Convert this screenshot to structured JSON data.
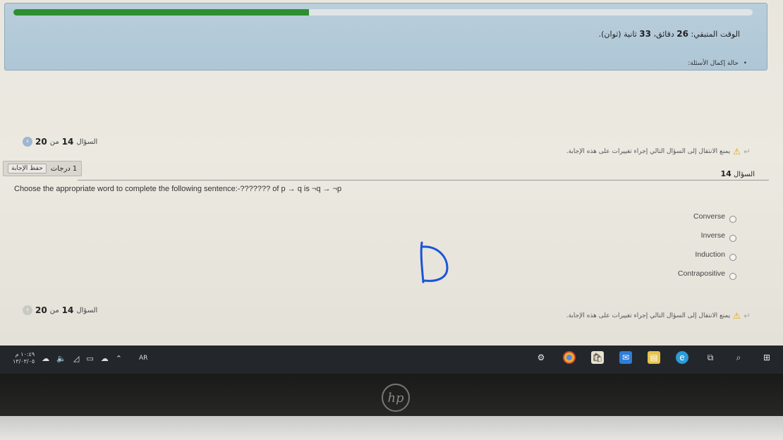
{
  "timer_panel": {
    "progress_fraction": 0.4,
    "time_remaining_label": "الوقت المتبقي:",
    "time_remaining_minutes": "26",
    "minutes_unit": "دقائق،",
    "time_remaining_seconds": "33",
    "seconds_unit": "ثانية (ثوان).",
    "question_status_label": "حالة إكمال الأسئلة:"
  },
  "navigation": {
    "prefix": "السؤال",
    "current": "14",
    "of": "من",
    "total": "20"
  },
  "warning": {
    "text": "يمنع الانتقال إلى السؤال التالي إجراء تغييرات على هذه الإجابة."
  },
  "question": {
    "number_label": "السؤال",
    "number": "14",
    "grade": "1 درجات",
    "save_button": "حفظ الإجابة",
    "text": "Choose the appropriate word to complete the following sentence:-??????? of p → q is ¬q → ¬p",
    "options": [
      "Converse",
      "Inverse",
      "Induction",
      "Contrapositive"
    ]
  },
  "taskbar": {
    "clock_time": "١٠:٤٩ م",
    "clock_date": "١٣/٠٣/٠٥",
    "language": "AR",
    "icons": [
      "settings-icon",
      "chrome-icon",
      "store-icon",
      "mail-icon",
      "files-icon",
      "edge-icon",
      "task-view-icon",
      "search-icon",
      "windows-start-icon"
    ]
  },
  "colors": {
    "progress": "#2f8f2f",
    "panel": "#b9cedb",
    "taskbar": "#23272b",
    "handwriting": "#1a55d8",
    "warning": "#e2a400"
  }
}
